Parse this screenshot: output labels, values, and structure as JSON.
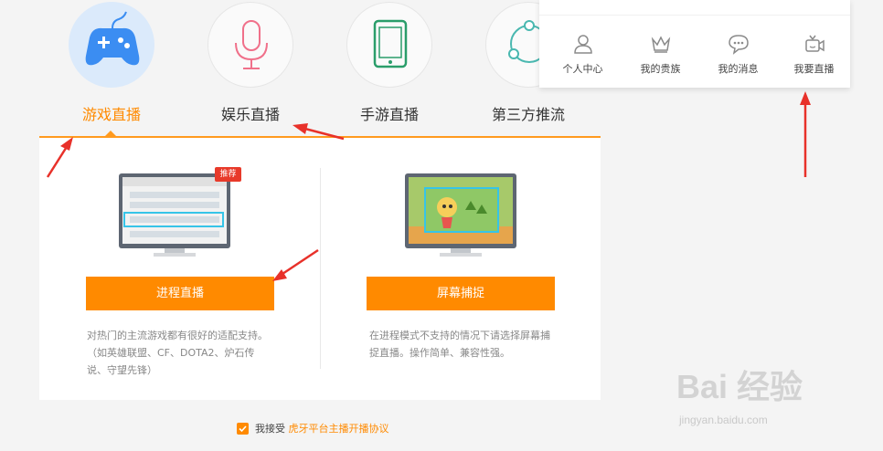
{
  "categories": [
    {
      "label": "游戏直播",
      "icon": "gamepad-icon",
      "active": true
    },
    {
      "label": "娱乐直播",
      "icon": "microphone-icon",
      "active": false
    },
    {
      "label": "手游直播",
      "icon": "tablet-icon",
      "active": false
    },
    {
      "label": "第三方推流",
      "icon": "share-nodes-icon",
      "active": false
    }
  ],
  "options": [
    {
      "button_label": "进程直播",
      "badge": "推荐",
      "description": "对热门的主流游戏都有很好的适配支持。（如英雄联盟、CF、DOTA2、炉石传说、守望先锋）"
    },
    {
      "button_label": "屏幕捕捉",
      "description": "在进程模式不支持的情况下请选择屏幕捕捉直播。操作简单、兼容性强。"
    }
  ],
  "agreement": {
    "prefix": "我接受",
    "link": "虎牙平台主播开播协议",
    "checked": true
  },
  "user_menu": [
    {
      "label": "个人中心",
      "icon": "person-icon"
    },
    {
      "label": "我的贵族",
      "icon": "crown-icon"
    },
    {
      "label": "我的消息",
      "icon": "chat-bubble-icon"
    },
    {
      "label": "我要直播",
      "icon": "live-camera-icon"
    }
  ],
  "watermark": {
    "brand": "Bai 经验",
    "url": "jingyan.baidu.com"
  },
  "colors": {
    "accent": "#ff8a00",
    "arrow": "#e8312a",
    "active_circle": "#dbeafb"
  }
}
